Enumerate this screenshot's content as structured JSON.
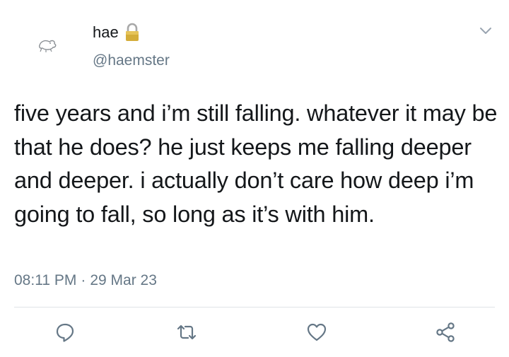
{
  "tweet": {
    "display_name": "hae",
    "handle": "@haemster",
    "text": "five years and i’m still falling. whatever it may be that he does? he just keeps me falling deeper and deeper. i actually don’t care how deep i’m going to fall, so long as it’s with him.",
    "time": "08:11 PM",
    "separator": "·",
    "date": "29 Mar 23"
  },
  "icons": {
    "lock": "lock-icon",
    "menu": "chevron-down-icon",
    "reply": "reply-icon",
    "retweet": "retweet-icon",
    "like": "heart-icon",
    "share": "share-icon"
  },
  "colors": {
    "text": "#14171a",
    "secondary": "#657786",
    "icon": "#657786",
    "divider": "#dfe3e7",
    "lock_body": "#c9a227"
  }
}
